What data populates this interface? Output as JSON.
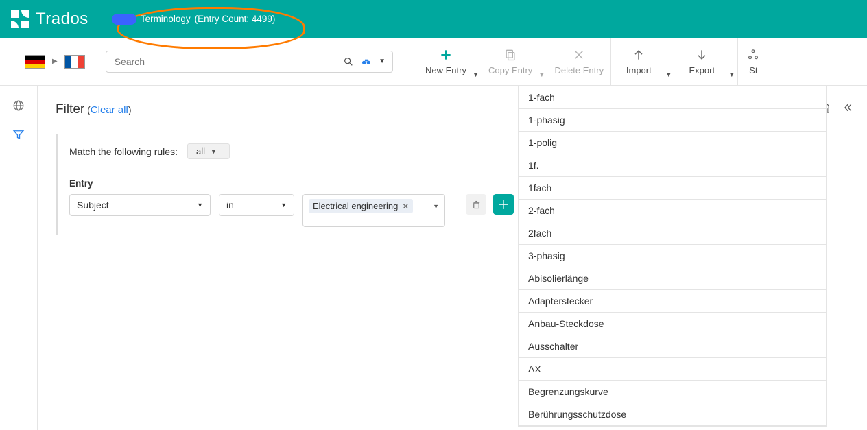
{
  "brand": {
    "name": "Trados"
  },
  "header": {
    "title_prefix": "Terminology",
    "entry_count_label": "(Entry Count: 4499)"
  },
  "toolbar": {
    "search_placeholder": "Search",
    "actions": {
      "new_entry": "New Entry",
      "copy_entry": "Copy Entry",
      "delete_entry": "Delete Entry",
      "import": "Import",
      "export": "Export",
      "structure": "St"
    }
  },
  "filter": {
    "title": "Filter",
    "clear_all": "Clear all",
    "match_label": "Match the following rules:",
    "match_mode": "all",
    "rule_label": "Entry",
    "field": "Subject",
    "operator": "in",
    "value_chip": "Electrical engineering"
  },
  "terms": [
    "1-fach",
    "1-phasig",
    "1-polig",
    "1f.",
    "1fach",
    "2-fach",
    "2fach",
    "3-phasig",
    "Abisolierlänge",
    "Adapterstecker",
    "Anbau-Steckdose",
    "Ausschalter",
    "AX",
    "Begrenzungskurve",
    "Berührungsschutzdose"
  ]
}
